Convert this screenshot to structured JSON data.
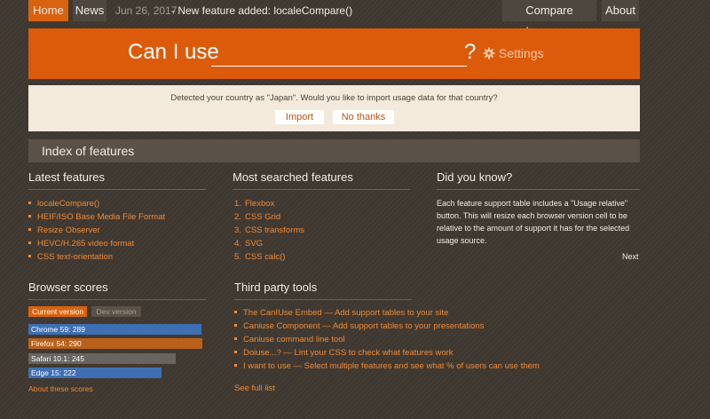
{
  "nav": {
    "home": "Home",
    "news": "News",
    "date": "Jun 26, 2017",
    "news_text": "- New feature added: localeCompare()",
    "compare": "Compare browsers",
    "about": "About"
  },
  "banner": {
    "title": "Can I use",
    "search_value": "",
    "question": "?",
    "settings": "Settings"
  },
  "notice": {
    "text": "Detected your country as \"Japan\". Would you like to import usage data for that country?",
    "import": "Import",
    "no_thanks": "No thanks"
  },
  "index_title": "Index of features",
  "latest": {
    "title": "Latest features",
    "items": [
      "localeCompare()",
      "HEIF/ISO Base Media File Format",
      "Resize Observer",
      "HEVC/H.265 video format",
      "CSS text-orientation"
    ]
  },
  "most_searched": {
    "title": "Most searched features",
    "items": [
      {
        "n": "1.",
        "label": "Flexbox"
      },
      {
        "n": "2.",
        "label": "CSS Grid"
      },
      {
        "n": "3.",
        "label": "CSS transforms"
      },
      {
        "n": "4.",
        "label": "SVG"
      },
      {
        "n": "5.",
        "label": "CSS calc()"
      }
    ]
  },
  "did_you_know": {
    "title": "Did you know?",
    "text": "Each feature support table includes a \"Usage relative\" button. This will resize each browser version cell to be relative to the amount of support it has for the selected usage source.",
    "next": "Next"
  },
  "browser_scores": {
    "title": "Browser scores",
    "tab_current": "Current version",
    "tab_dev": "Dev version",
    "rows": [
      {
        "label": "Chrome 59: 289",
        "score": 289,
        "color": "#3e6fb3"
      },
      {
        "label": "Firefox 54: 290",
        "score": 290,
        "color": "#b9601a"
      },
      {
        "label": "Safari 10.1: 245",
        "score": 245,
        "color": "#6a645e"
      },
      {
        "label": "Edge 15: 222",
        "score": 222,
        "color": "#3e6fb3"
      }
    ],
    "about": "About these scores"
  },
  "third_party": {
    "title": "Third party tools",
    "items": [
      "The CanIUse Embed — Add support tables to your site",
      "Caniuse Component — Add support tables to your presentations",
      "Caniuse command line tool",
      "Doiuse...? — Lint your CSS to check what features work",
      "I want to use — Select multiple features and see what % of users can use them"
    ],
    "see_full": "See full list"
  },
  "colors": {
    "accent": "#dc5b0a",
    "link": "#f08a33",
    "background": "#3f3831"
  }
}
